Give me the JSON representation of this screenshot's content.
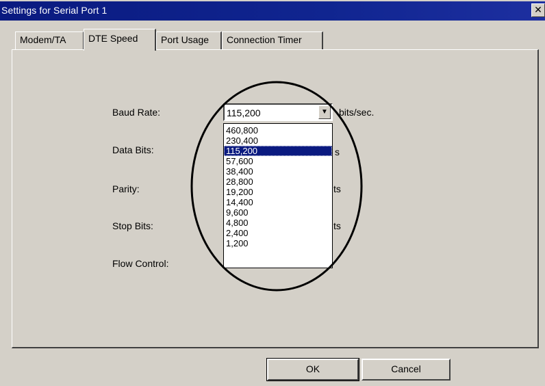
{
  "window": {
    "title": "Settings for Serial Port 1",
    "close_glyph": "✕"
  },
  "tabs": [
    {
      "label": "Modem/TA"
    },
    {
      "label": "DTE Speed",
      "active": true
    },
    {
      "label": "Port Usage"
    },
    {
      "label": "Connection Timer"
    }
  ],
  "form": {
    "baud_rate_label": "Baud Rate:",
    "baud_rate_value": "115,200",
    "baud_rate_unit": "bits/sec.",
    "data_bits_label": "Data Bits:",
    "parity_label": "Parity:",
    "stop_bits_label": "Stop Bits:",
    "flow_control_label": "Flow Control:",
    "partial_suffix_1": "s",
    "partial_suffix_2": "ts",
    "partial_suffix_3": "ts"
  },
  "baud_options": [
    "460,800",
    "230,400",
    "115,200",
    "57,600",
    "38,400",
    "28,800",
    "19,200",
    "14,400",
    "9,600",
    "4,800",
    "2,400",
    "1,200"
  ],
  "selected_option": "115,200",
  "buttons": {
    "ok": "OK",
    "cancel": "Cancel"
  },
  "colors": {
    "titlebar": "#0a1a80",
    "face": "#d4d0c8",
    "selection": "#0a1a80"
  }
}
